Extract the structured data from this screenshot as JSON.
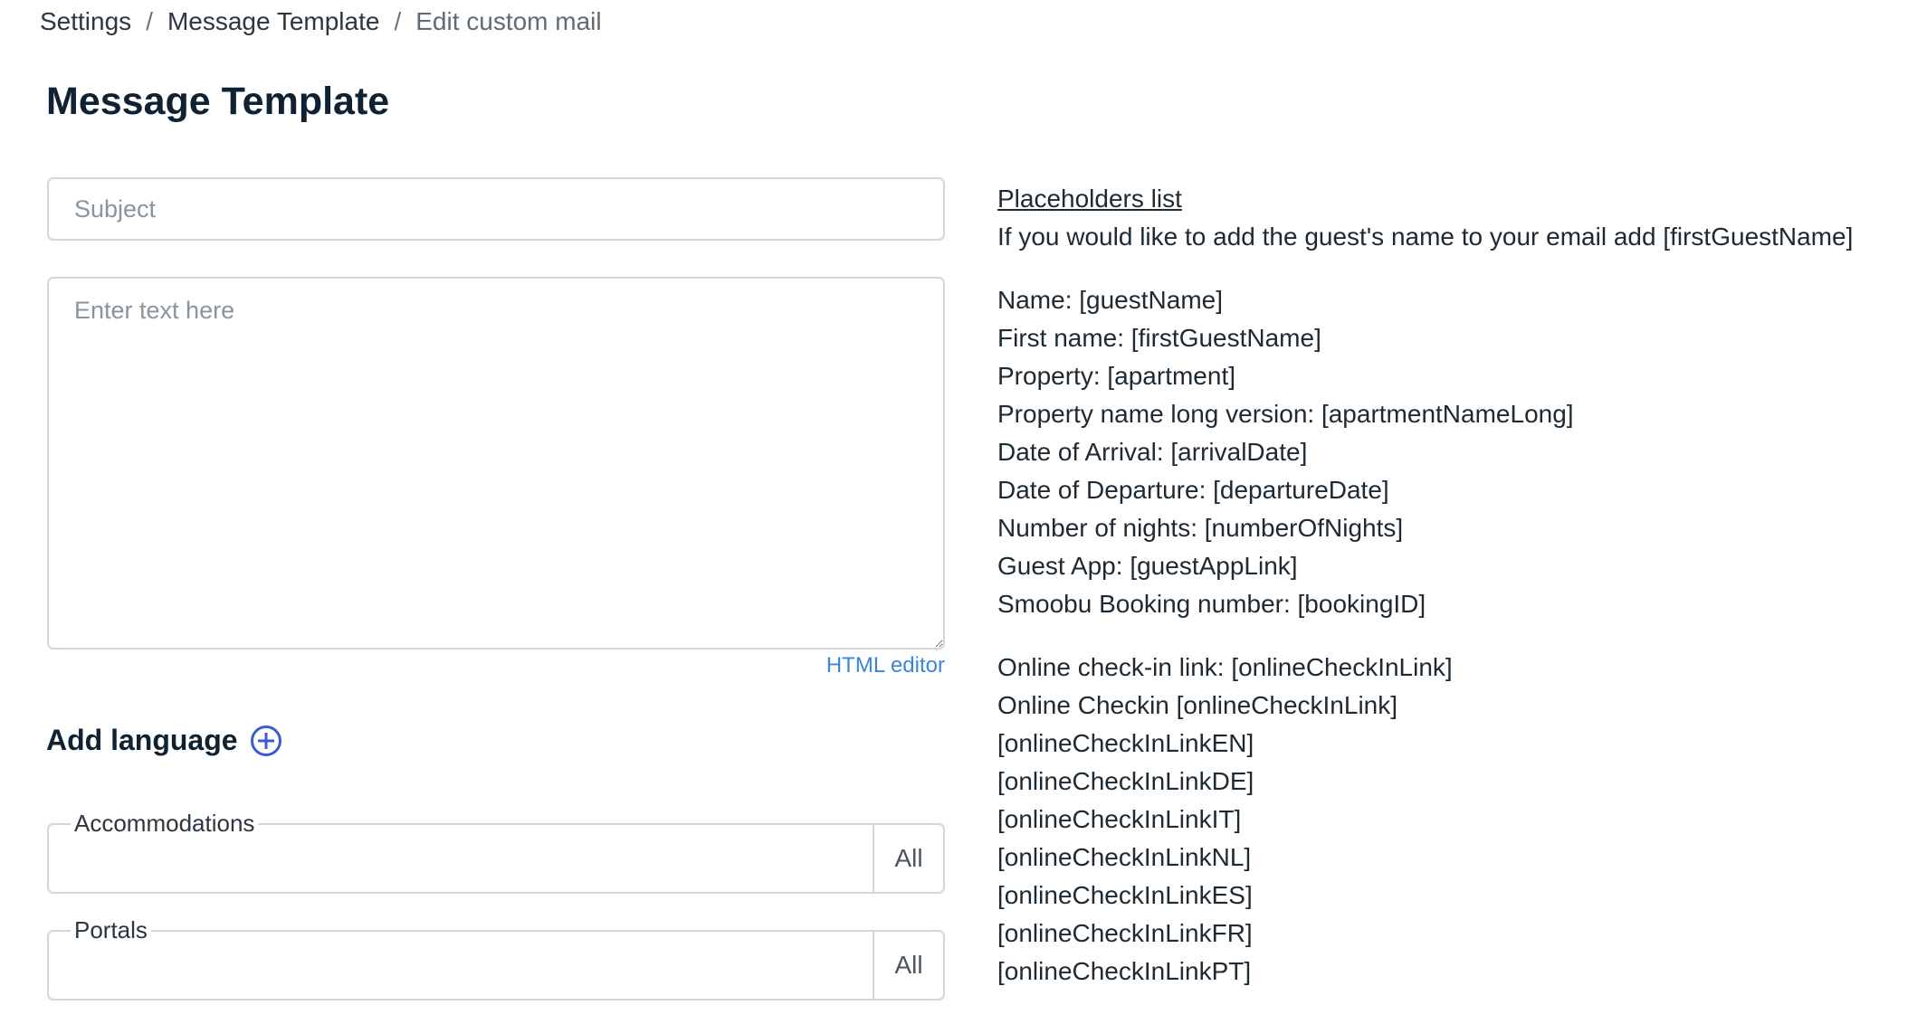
{
  "breadcrumb": {
    "items": [
      "Settings",
      "Message Template"
    ],
    "current": "Edit custom mail",
    "separator": "/"
  },
  "page_title": "Message Template",
  "form": {
    "subject_placeholder": "Subject",
    "subject_value": "",
    "body_placeholder": "Enter text here",
    "body_value": "",
    "html_editor_label": "HTML editor"
  },
  "add_language": {
    "label": "Add language",
    "icon": "plus-circle-icon"
  },
  "filters": {
    "accommodations": {
      "label": "Accommodations",
      "value": "All"
    },
    "portals": {
      "label": "Portals",
      "value": "All"
    }
  },
  "placeholders": {
    "link_label": "Placeholders list",
    "intro": "If you would like to add the guest's name to your email add [firstGuestName]",
    "group1": [
      "Name: [guestName]",
      "First name: [firstGuestName]",
      "Property: [apartment]",
      "Property name long version: [apartmentNameLong]",
      "Date of Arrival: [arrivalDate]",
      "Date of Departure: [departureDate]",
      "Number of nights: [numberOfNights]",
      "Guest App: [guestAppLink]",
      "Smoobu Booking number: [bookingID]"
    ],
    "group2": [
      "Online check-in link: [onlineCheckInLink]",
      "Online Checkin [onlineCheckInLink]",
      "[onlineCheckInLinkEN]",
      "[onlineCheckInLinkDE]",
      "[onlineCheckInLinkIT]",
      "[onlineCheckInLinkNL]",
      "[onlineCheckInLinkES]",
      "[onlineCheckInLinkFR]",
      "[onlineCheckInLinkPT]"
    ]
  },
  "colors": {
    "link": "#3b86d6",
    "accent": "#3b5bd6",
    "title": "#0f2233",
    "border": "#d3d7db"
  }
}
